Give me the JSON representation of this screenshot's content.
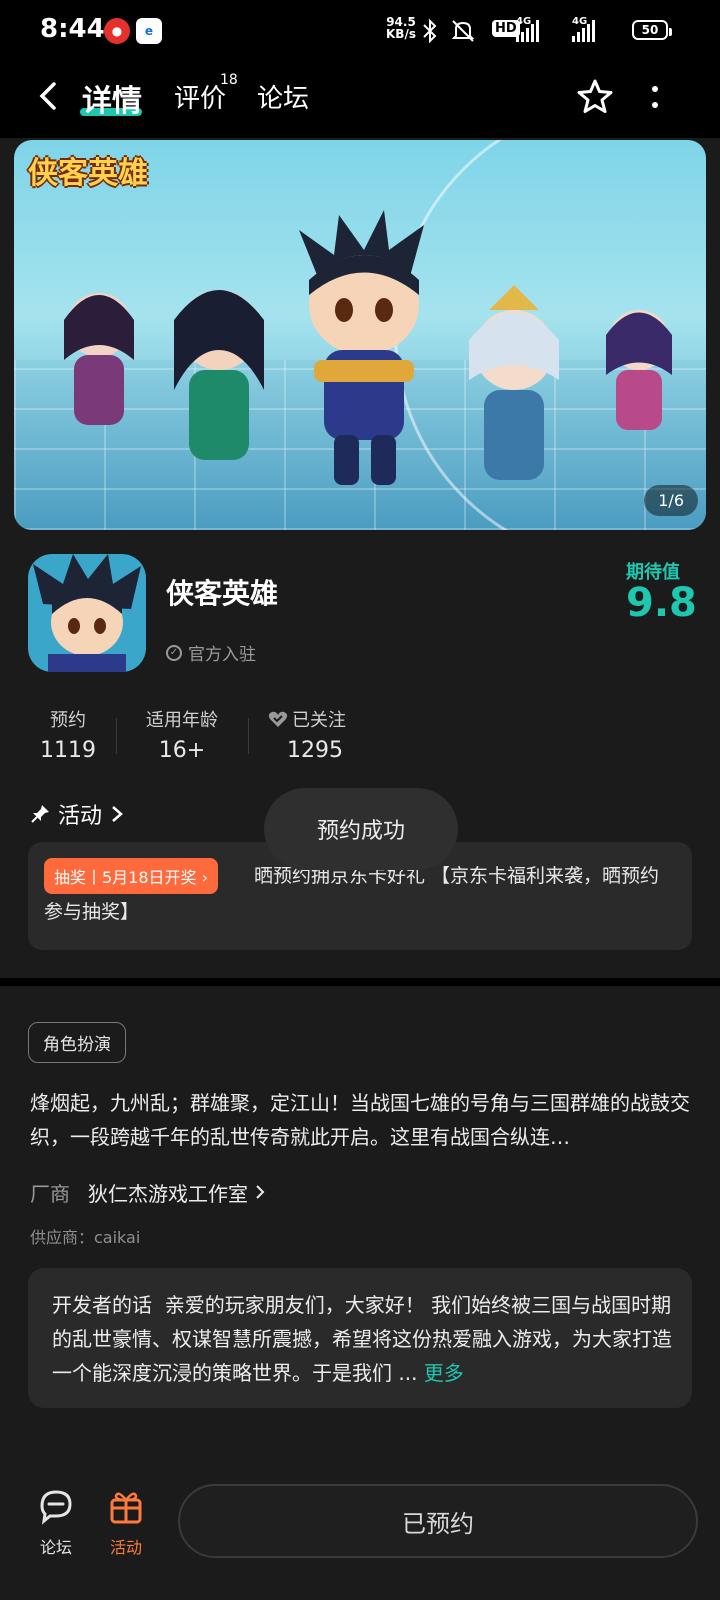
{
  "status_bar": {
    "time": "8:44",
    "net_speed_value": "94.5",
    "net_speed_unit": "KB/s",
    "hd_label": "HD",
    "signal_labels": [
      "4G",
      "4G"
    ],
    "battery": "50"
  },
  "nav": {
    "tabs": [
      {
        "label": "详情",
        "active": true
      },
      {
        "label": "评价",
        "badge": "18"
      },
      {
        "label": "论坛"
      }
    ]
  },
  "banner": {
    "logo_text": "侠客英雄",
    "counter": "1/6"
  },
  "app": {
    "name": "侠客英雄",
    "verified": "官方入驻",
    "score_label": "期待值",
    "score": "9.8"
  },
  "stats": [
    {
      "label": "预约",
      "value": "1119"
    },
    {
      "label": "适用年龄",
      "value": "16+"
    },
    {
      "label": "已关注",
      "value": "1295"
    }
  ],
  "activity": {
    "heading": "活动",
    "tag": "抽奖丨5月18日开奖",
    "text": "晒预约拥京东卡好礼 【京东卡福利来袭，晒预约参与抽奖】"
  },
  "toast": "预约成功",
  "genre": "角色扮演",
  "description": "烽烟起，九州乱；群雄聚，定江山！当战国七雄的号角与三国群雄的战鼓交织，一段跨越千年的乱世传奇就此开启。这里有战国合纵连…",
  "developer": {
    "label": "厂商",
    "name": "狄仁杰游戏工作室"
  },
  "supplier": "供应商：caikai",
  "dev_note": {
    "title": "开发者的话",
    "text": "亲爱的玩家朋友们，大家好！ 我们始终被三国与战国时期的乱世豪情、权谋智慧所震撼，希望将这份热爱融入游戏，为大家打造一个能深度沉浸的策略世界。于是我们 ...",
    "more": "更多"
  },
  "bottom_bar": {
    "forum_label": "论坛",
    "activity_label": "活动",
    "reserved_label": "已预约"
  },
  "colors": {
    "accent": "#1ec7b0",
    "tag_orange": "#ff6a3d",
    "background": "#1b1b1b"
  }
}
